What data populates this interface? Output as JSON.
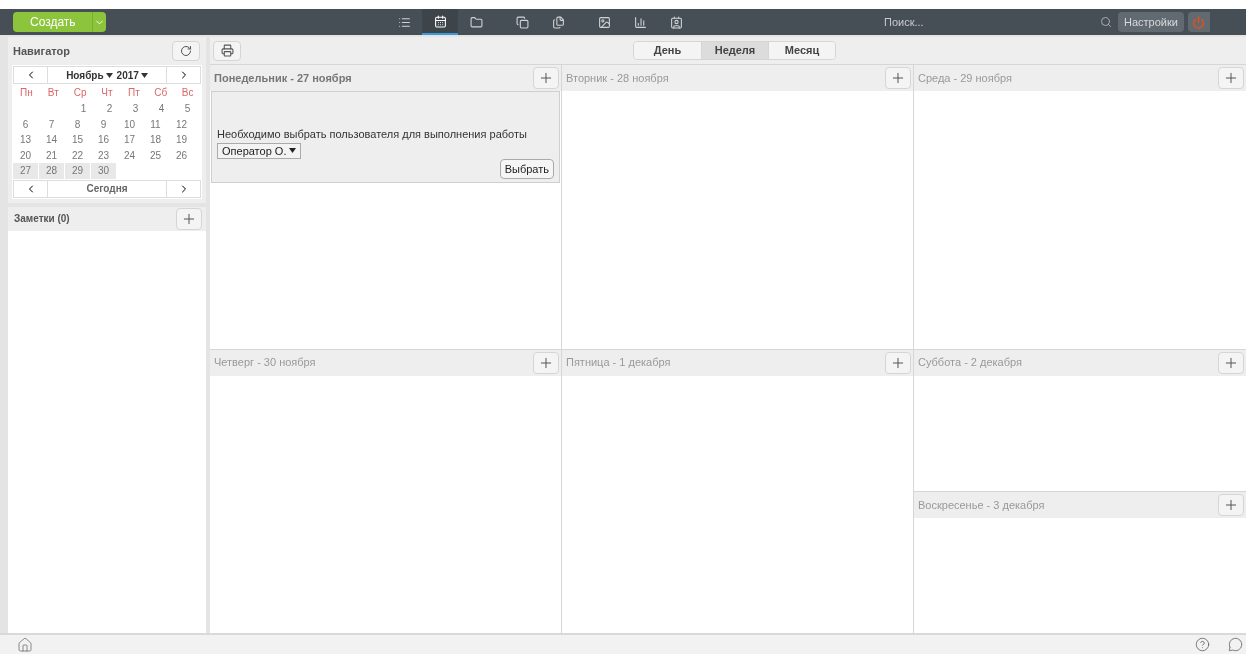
{
  "topbar": {
    "create_button": "Создать",
    "nav_icons": [
      {
        "kind": "list",
        "selected": false
      },
      {
        "kind": "calendar",
        "selected": true
      },
      {
        "kind": "folder",
        "selected": false
      },
      {
        "kind": "docs",
        "selected": false
      },
      {
        "kind": "docs-filled",
        "selected": false
      },
      {
        "kind": "picture",
        "selected": false
      },
      {
        "kind": "chart",
        "selected": false
      },
      {
        "kind": "contact",
        "selected": false
      }
    ],
    "search": {
      "placeholder": "Поиск..."
    },
    "settings_button": "Настройки"
  },
  "navigator": {
    "title": "Навигатор",
    "month": "Ноябрь",
    "year": "2017",
    "weekdays": [
      "Пн",
      "Вт",
      "Ср",
      "Чт",
      "Пт",
      "Сб",
      "Вс"
    ],
    "weeks": [
      [
        {
          "day": "1",
          "current_week": false
        },
        {
          "day": "2",
          "current_week": false
        },
        {
          "day": "3",
          "current_week": false
        },
        {
          "day": "4",
          "current_week": false
        },
        {
          "day": "5",
          "current_week": false
        }
      ],
      [
        {
          "day": "6",
          "current_week": false
        },
        {
          "day": "7",
          "current_week": false
        },
        {
          "day": "8",
          "current_week": false
        },
        {
          "day": "9",
          "current_week": false
        },
        {
          "day": "10",
          "current_week": false
        },
        {
          "day": "11",
          "current_week": false
        },
        {
          "day": "12",
          "current_week": false
        }
      ],
      [
        {
          "day": "13",
          "current_week": false
        },
        {
          "day": "14",
          "current_week": false
        },
        {
          "day": "15",
          "current_week": false
        },
        {
          "day": "16",
          "current_week": false
        },
        {
          "day": "17",
          "current_week": false
        },
        {
          "day": "18",
          "current_week": false
        },
        {
          "day": "19",
          "current_week": false
        }
      ],
      [
        {
          "day": "20",
          "current_week": false
        },
        {
          "day": "21",
          "current_week": false
        },
        {
          "day": "22",
          "current_week": false
        },
        {
          "day": "23",
          "current_week": false
        },
        {
          "day": "24",
          "current_week": false
        },
        {
          "day": "25",
          "current_week": false
        },
        {
          "day": "26",
          "current_week": false
        }
      ],
      [
        {
          "day": "27",
          "current_week": true
        },
        {
          "day": "28",
          "current_week": true
        },
        {
          "day": "29",
          "current_week": true
        },
        {
          "day": "30",
          "current_week": true
        }
      ]
    ],
    "today_button": "Сегодня"
  },
  "notes": {
    "title": "Заметки (0)"
  },
  "view_tabs": [
    {
      "label": "День",
      "selected": false
    },
    {
      "label": "Неделя",
      "selected": true
    },
    {
      "label": "Месяц",
      "selected": false
    }
  ],
  "days": [
    {
      "title": "Понедельник - 27 ноября",
      "today": true,
      "task": {
        "message": "Необходимо выбрать пользователя для выполнения работы",
        "user_select": "Оператор О.",
        "button": "Выбрать"
      }
    },
    {
      "title": "Вторник - 28 ноября",
      "today": false
    },
    {
      "title": "Среда - 29 ноября",
      "today": false
    },
    {
      "title": "Четверг - 30 ноября",
      "today": false
    },
    {
      "title": "Пятница - 1 декабря",
      "today": false
    },
    {
      "title": "Суббота - 2 декабря",
      "today": false
    },
    {
      "title": "Воскресенье - 3 декабря",
      "today": false
    }
  ]
}
